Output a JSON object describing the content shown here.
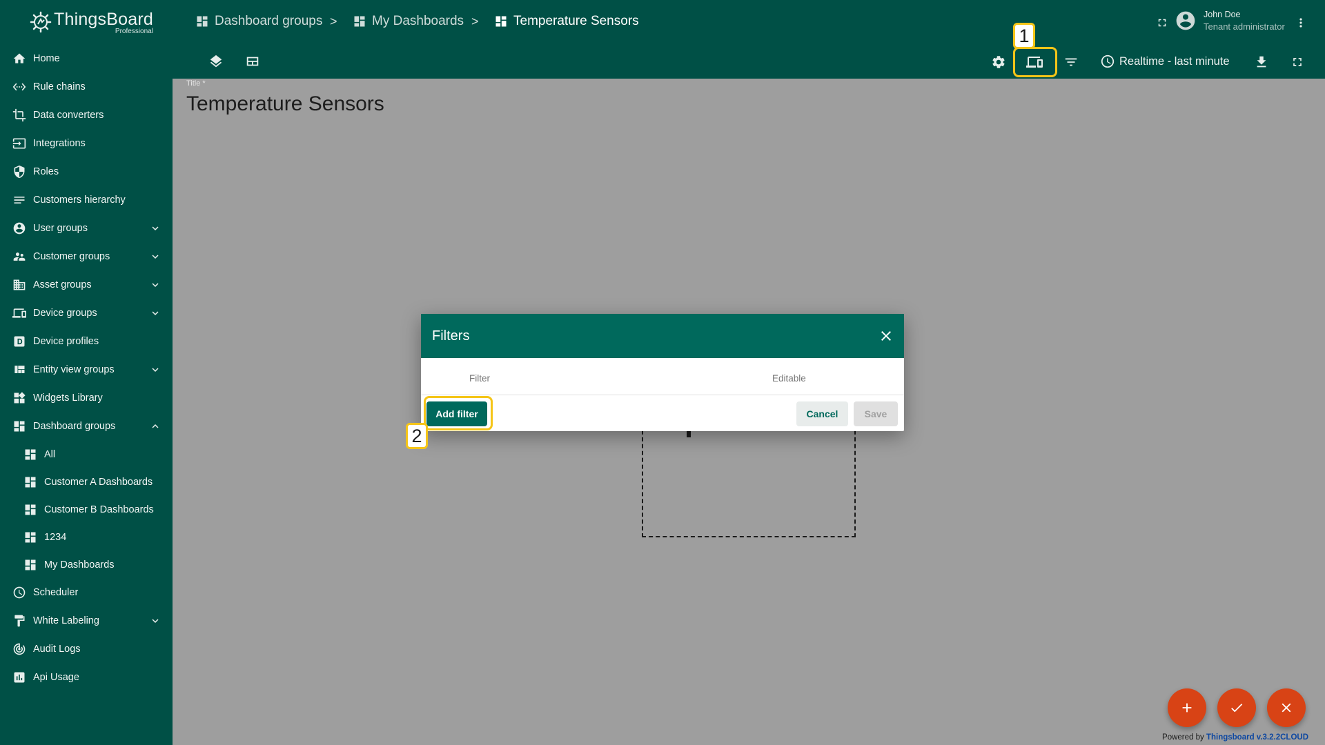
{
  "app": {
    "brand_name": "ThingsBoard",
    "brand_edition": "Professional"
  },
  "sidebar": {
    "items": [
      {
        "label": "Home",
        "icon": "home-icon"
      },
      {
        "label": "Rule chains",
        "icon": "rule-chains-icon"
      },
      {
        "label": "Data converters",
        "icon": "data-converters-icon"
      },
      {
        "label": "Integrations",
        "icon": "integrations-icon"
      },
      {
        "label": "Roles",
        "icon": "shield-icon"
      },
      {
        "label": "Customers hierarchy",
        "icon": "hierarchy-icon"
      },
      {
        "label": "User groups",
        "icon": "account-circle-icon",
        "expandable": true
      },
      {
        "label": "Customer groups",
        "icon": "supervisor-icon",
        "expandable": true
      },
      {
        "label": "Asset groups",
        "icon": "domain-icon",
        "expandable": true
      },
      {
        "label": "Device groups",
        "icon": "devices-icon",
        "expandable": true
      },
      {
        "label": "Device profiles",
        "icon": "device-profile-icon"
      },
      {
        "label": "Entity view groups",
        "icon": "view-quilt-icon",
        "expandable": true
      },
      {
        "label": "Widgets Library",
        "icon": "widgets-icon"
      },
      {
        "label": "Dashboard groups",
        "icon": "dashboard-icon",
        "expanded": true
      },
      {
        "label": "All",
        "icon": "dashboard-icon",
        "sub": true
      },
      {
        "label": "Customer A Dashboards",
        "icon": "dashboard-icon",
        "sub": true
      },
      {
        "label": "Customer B Dashboards",
        "icon": "dashboard-icon",
        "sub": true
      },
      {
        "label": "1234",
        "icon": "dashboard-icon",
        "sub": true
      },
      {
        "label": "My Dashboards",
        "icon": "dashboard-icon",
        "sub": true
      },
      {
        "label": "Scheduler",
        "icon": "schedule-icon"
      },
      {
        "label": "White Labeling",
        "icon": "format-paint-icon",
        "expandable": true
      },
      {
        "label": "Audit Logs",
        "icon": "track-changes-icon"
      },
      {
        "label": "Api Usage",
        "icon": "insert-chart-icon"
      }
    ]
  },
  "header": {
    "breadcrumbs": [
      "Dashboard groups",
      "My Dashboards",
      "Temperature Sensors"
    ],
    "separator": ">",
    "user_name": "John Doe",
    "user_role": "Tenant administrator",
    "timewindow": "Realtime - last minute"
  },
  "main": {
    "title_label": "Title *",
    "title": "Temperature Sensors"
  },
  "dialog": {
    "title": "Filters",
    "columns": [
      "Filter",
      "Editable"
    ],
    "add_filter_label": "Add filter",
    "cancel_label": "Cancel",
    "save_label": "Save"
  },
  "annotations": {
    "marker_1": "1",
    "marker_2": "2",
    "highlight_color": "#f5c518"
  },
  "footer": {
    "powered_prefix": "Powered by",
    "powered_link": "Thingsboard v.3.2.2CLOUD"
  },
  "colors": {
    "primary": "#005046",
    "dialog_header": "#00695c",
    "fab": "#d84315"
  }
}
